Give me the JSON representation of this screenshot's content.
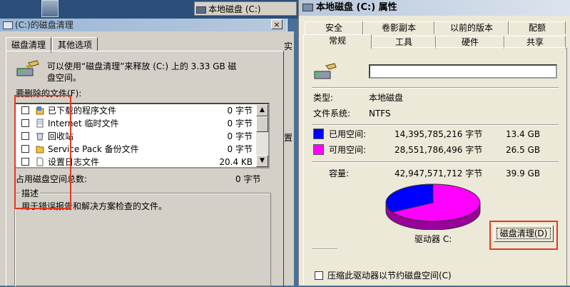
{
  "background": {
    "task_item": "本地磁盘 (C:)",
    "stray_char": "实",
    "stray_char2": "置"
  },
  "cleanup_dialog": {
    "title": "(C:)的磁盘清理",
    "close_glyph": "×",
    "tabs": [
      "磁盘清理",
      "其他选项"
    ],
    "intro_line1": "可以使用“磁盘清理”来释放  (C:) 上的 3.33 GB 磁",
    "intro_line2": "盘空间。",
    "files_label": "要删除的文件(F):",
    "files": [
      {
        "name": "已下载的程序文件",
        "size": "0 字节",
        "icon": "folder-icon"
      },
      {
        "name": "Internet 临时文件",
        "size": "0 字节",
        "icon": "document-icon"
      },
      {
        "name": "回收站",
        "size": "0 字节",
        "icon": "recycle-bin-icon"
      },
      {
        "name": "Service Pack 备份文件",
        "size": "0 字节",
        "icon": "folder-icon"
      },
      {
        "name": "设置日志文件",
        "size": "20.4 KB",
        "icon": "blank-file-icon"
      }
    ],
    "total_label": "占用磁盘空间总数:",
    "total_value": "0 字节",
    "desc_heading": "描述",
    "desc_text": "用于错误报告和解决方案检查的文件。"
  },
  "properties_dialog": {
    "title": "本地磁盘 (C:) 属性",
    "tabs_row1": [
      "安全",
      "卷影副本",
      "以前的版本",
      "配额"
    ],
    "tabs_row2": [
      "常规",
      "工具",
      "硬件",
      "共享"
    ],
    "name_value": "",
    "type_label": "类型:",
    "type_value": "本地磁盘",
    "fs_label": "文件系统:",
    "fs_value": "NTFS",
    "used_label": "已用空间:",
    "used_bytes": "14,395,785,216 字节",
    "used_gb": "13.4 GB",
    "free_label": "可用空间:",
    "free_bytes": "28,551,786,496 字节",
    "free_gb": "26.5 GB",
    "capacity_label": "容量:",
    "capacity_bytes": "42,947,571,712 字节",
    "capacity_gb": "39.9 GB",
    "drive_label": "驱动器 C:",
    "cleanup_button": "磁盘清理(D)",
    "compress_label": "压缩此驱动器以节约磁盘空间(C)",
    "used_fraction": 0.335,
    "colors": {
      "used": "#0000ff",
      "free": "#ff00ff",
      "highlight": "#e23a20"
    }
  }
}
